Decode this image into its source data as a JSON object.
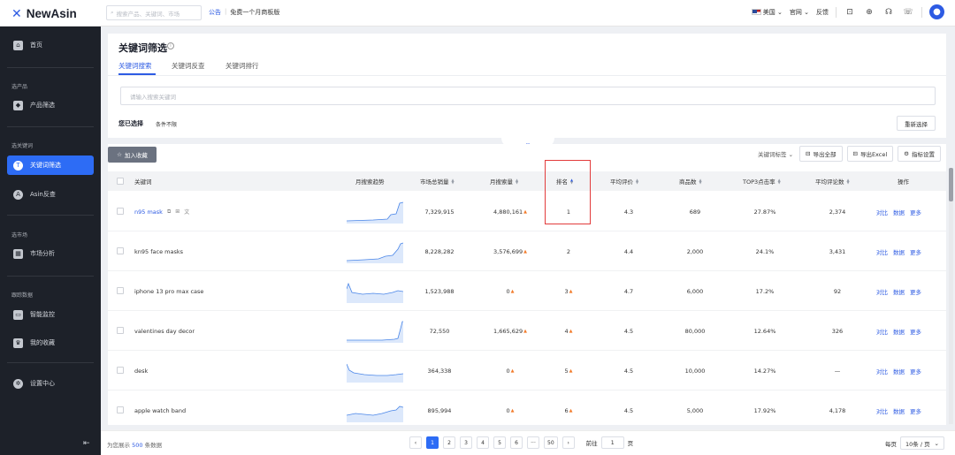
{
  "brand": {
    "name": "NewAsin"
  },
  "topbar": {
    "search_placeholder": "搜索产品、关键词、市场",
    "notice_label": "公告",
    "notice_text": "免费一个月商板版",
    "marketplace": "美国",
    "site": "官网",
    "feedback": "反馈"
  },
  "sidebar": {
    "home": "首页",
    "sec_product": "选产品",
    "product_filter": "产品筛选",
    "sec_keyword": "选关键词",
    "keyword_filter": "关键词筛选",
    "asin_reverse": "Asin反查",
    "sec_market": "选市场",
    "market_analysis": "市场分析",
    "sec_tracking": "跟踪数据",
    "smart_monitor": "智能监控",
    "my_favorites": "我的收藏",
    "settings": "设置中心"
  },
  "page": {
    "title": "关键词筛选",
    "tabs": [
      "关键词搜索",
      "关键词反查",
      "关键词排行"
    ],
    "input_placeholder": "请输入搜索关键词",
    "selected_label": "您已选择",
    "condition": "条件不限",
    "reset": "重新选择"
  },
  "toolbar": {
    "add_favorite": "加入收藏",
    "kw_tag": "关键词标签",
    "export_all": "导出全部",
    "export_excel": "导出Excel",
    "metric_settings": "指标设置"
  },
  "table": {
    "headers": [
      "关键词",
      "月搜索趋势",
      "市场总销量",
      "月搜索量",
      "排名",
      "平均评价",
      "商品数",
      "TOP3点击率",
      "平均评论数",
      "操作"
    ],
    "ops": [
      "对比",
      "数据",
      "更多"
    ],
    "rows": [
      {
        "keyword": "n95 mask",
        "market_sales": "7,329,915",
        "monthly_search": "4,880,161",
        "rank": "1",
        "avg_rating": "4.3",
        "products": "689",
        "top3_ctr": "27.87%",
        "avg_reviews": "2,374"
      },
      {
        "keyword": "kn95 face masks",
        "market_sales": "8,228,282",
        "monthly_search": "3,576,699",
        "rank": "2",
        "avg_rating": "4.4",
        "products": "2,000",
        "top3_ctr": "24.1%",
        "avg_reviews": "3,431"
      },
      {
        "keyword": "iphone 13 pro max case",
        "market_sales": "1,523,988",
        "monthly_search": "0",
        "rank": "3",
        "avg_rating": "4.7",
        "products": "6,000",
        "top3_ctr": "17.2%",
        "avg_reviews": "92"
      },
      {
        "keyword": "valentines day decor",
        "market_sales": "72,550",
        "monthly_search": "1,665,629",
        "rank": "4",
        "avg_rating": "4.5",
        "products": "80,000",
        "top3_ctr": "12.64%",
        "avg_reviews": "326"
      },
      {
        "keyword": "desk",
        "market_sales": "364,338",
        "monthly_search": "0",
        "rank": "5",
        "avg_rating": "4.5",
        "products": "10,000",
        "top3_ctr": "14.27%",
        "avg_reviews": "—"
      },
      {
        "keyword": "apple watch band",
        "market_sales": "895,994",
        "monthly_search": "0",
        "rank": "6",
        "avg_rating": "4.5",
        "products": "5,000",
        "top3_ctr": "17.92%",
        "avg_reviews": "4,178"
      }
    ]
  },
  "footer": {
    "total_prefix": "为您展示",
    "total_count": "500",
    "total_suffix": "条数据",
    "pages": [
      "1",
      "2",
      "3",
      "4",
      "5",
      "6",
      "···",
      "50"
    ],
    "goto_label": "前往",
    "goto_value": "1",
    "goto_suffix": "页",
    "per_page_label": "每页",
    "per_page_value": "10条 / 页"
  },
  "colors": {
    "accent": "#2d6cf5",
    "sidebar_bg": "#1d2129",
    "highlight": "#e23b3b",
    "up_arrow": "#f27b2b"
  }
}
